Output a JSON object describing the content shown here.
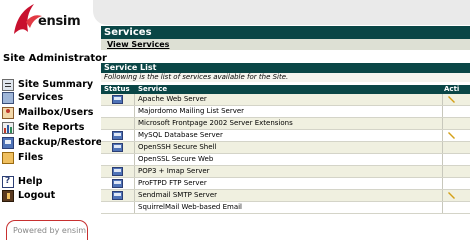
{
  "brand": {
    "name": "ensim"
  },
  "sidebar": {
    "role": "Site Administrator",
    "items": [
      {
        "label": "Site Summary",
        "icon": "summary-icon"
      },
      {
        "label": "Services",
        "icon": "services-icon"
      },
      {
        "label": "Mailbox/Users",
        "icon": "users-icon"
      },
      {
        "label": "Site Reports",
        "icon": "reports-icon"
      },
      {
        "label": "Backup/Restore",
        "icon": "backup-icon"
      },
      {
        "label": "Files",
        "icon": "folder-icon"
      },
      {
        "label": "Help",
        "icon": "help-icon"
      },
      {
        "label": "Logout",
        "icon": "logout-icon"
      }
    ],
    "powered_by": "Powered by ensim"
  },
  "main": {
    "title": "Services",
    "view_link": "View Services",
    "list_title": "Service List",
    "list_description": "Following is the list of services available for the Site.",
    "columns": {
      "status": "Status",
      "service": "Service",
      "action": "Acti"
    },
    "rows": [
      {
        "service": "Apache Web Server",
        "status_icon": true,
        "action_icon": true
      },
      {
        "service": "Majordomo Mailing List Server",
        "status_icon": false,
        "action_icon": false
      },
      {
        "service": "Microsoft Frontpage 2002 Server Extensions",
        "status_icon": false,
        "action_icon": false
      },
      {
        "service": "MySQL Database Server",
        "status_icon": true,
        "action_icon": true
      },
      {
        "service": "OpenSSH Secure Shell",
        "status_icon": true,
        "action_icon": false
      },
      {
        "service": "OpenSSL Secure Web",
        "status_icon": false,
        "action_icon": false
      },
      {
        "service": "POP3 + Imap Server",
        "status_icon": true,
        "action_icon": false
      },
      {
        "service": "ProFTPD FTP Server",
        "status_icon": true,
        "action_icon": false
      },
      {
        "service": "Sendmail SMTP Server",
        "status_icon": true,
        "action_icon": true
      },
      {
        "service": "SquirrelMail Web-based Email",
        "status_icon": false,
        "action_icon": false
      }
    ]
  },
  "colors": {
    "header_bar": "#0a4646",
    "row_alt": "#f0f0e0",
    "logo_red": "#c8102e",
    "link_bar": "#dde0d4"
  }
}
